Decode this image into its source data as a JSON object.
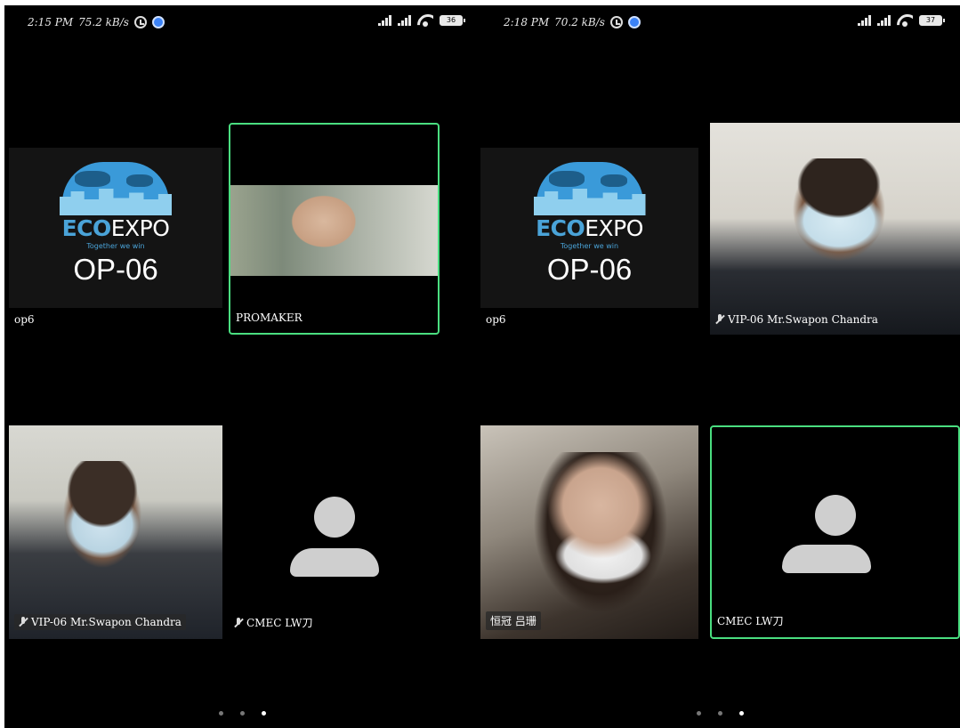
{
  "left": {
    "status": {
      "time": "2:15 PM",
      "speed": "75.2 kB/s",
      "battery": "36"
    },
    "tiles": {
      "op6": {
        "code": "OP-06",
        "name": "op6"
      },
      "promaker": {
        "name": "PROMAKER"
      },
      "swapon": {
        "name": "VIP-06 Mr.Swapon Chandra"
      },
      "cmec": {
        "name": "CMEC LW刀"
      }
    }
  },
  "right": {
    "status": {
      "time": "2:18 PM",
      "speed": "70.2 kB/s",
      "battery": "37"
    },
    "tiles": {
      "op6": {
        "code": "OP-06",
        "name": "op6"
      },
      "swapon": {
        "name": "VIP-06 Mr.Swapon Chandra"
      },
      "lv": {
        "name": "恒冠 吕珊"
      },
      "cmec": {
        "name": "CMEC LW刀"
      }
    }
  },
  "logo": {
    "eco": "ECO",
    "expo": "EXPO",
    "tagline": "Together we win"
  },
  "colors": {
    "active_border": "#4ade80",
    "avatar": "#cfcfcf",
    "background": "#000000"
  }
}
